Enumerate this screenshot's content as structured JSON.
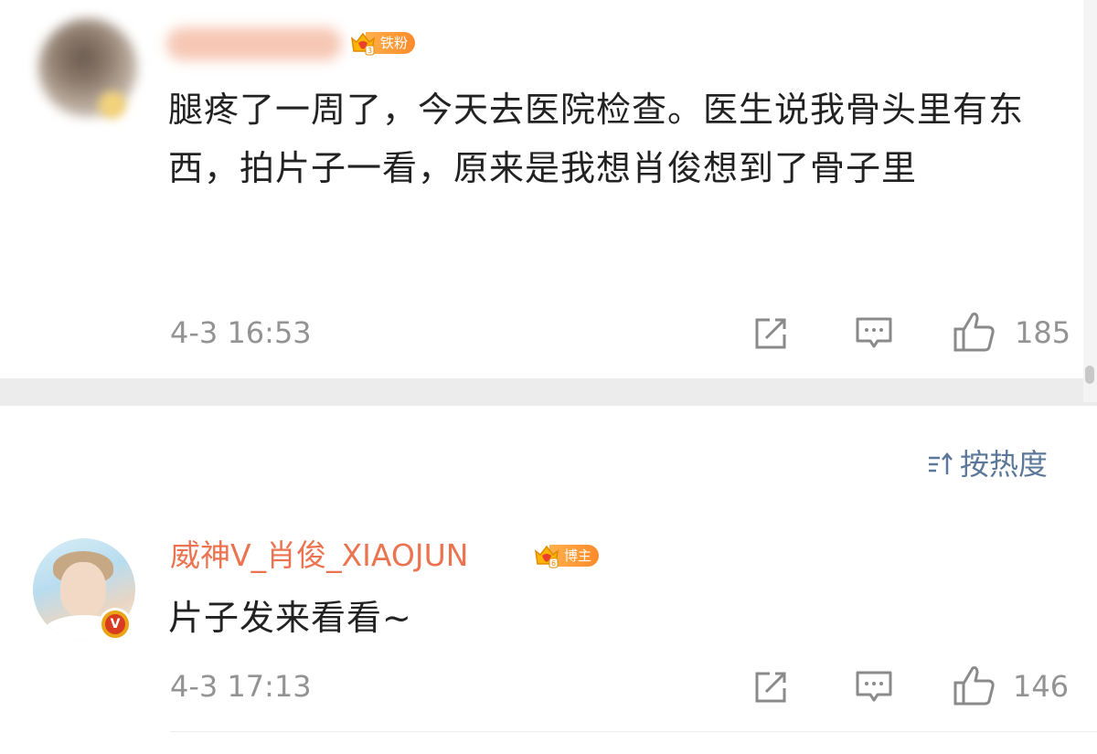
{
  "comment_1": {
    "text": "腿疼了一周了，今天去医院检查。医生说我骨头里有东西，拍片子一看，原来是我想肖俊想到了骨子里",
    "badge_label": "铁粉",
    "timestamp": "4-3 16:53",
    "like_count": "185"
  },
  "sort": {
    "label": "按热度"
  },
  "comment_2": {
    "username": "威神V_肖俊_XIAOJUN",
    "badge_label": "博主",
    "text": "片子发来看看~",
    "timestamp": "4-3 17:13",
    "like_count": "146"
  },
  "colors": {
    "username": "#eb7350",
    "meta": "#939393",
    "sort": "#5b7799",
    "badge": "#ff8a2b"
  },
  "icons": [
    "repost-icon",
    "comment-icon",
    "like-icon",
    "sort-icon",
    "crown-icon",
    "verified-icon"
  ]
}
